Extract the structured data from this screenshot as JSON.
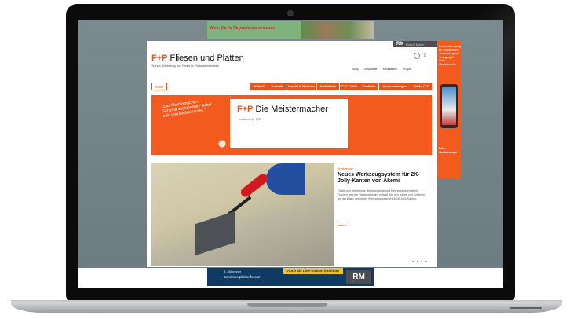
{
  "site": {
    "logo_prefix": "F+P",
    "logo_name": "Fliesen und Platten",
    "tagline": "Technik, Gestaltung und Trends für Fliesenfachbetriebe",
    "top_links": [
      "Shop",
      "Newsletter",
      "Mediadaten",
      "ePaper"
    ],
    "publisher_badge": "RM",
    "publisher_sub": "Rudolf Müller"
  },
  "top_banner": {
    "text": "Wenn Sie Ihr Netzwerk hier einsetzen"
  },
  "nav": {
    "home": "Home",
    "items": [
      "Aktuell",
      "Technik",
      "Handel & Betriebe",
      "Architektur",
      "F+P PLUS",
      "Produkte",
      "Veranstaltungen",
      "Mehr F+P"
    ]
  },
  "promo": {
    "speech": "„Das Meistermacher-Schema angemeldet? Dabei sein und leichter lernen.“",
    "title_prefix": "F+P",
    "title": "Die Meistermacher",
    "sub": "powered by PCI"
  },
  "article": {
    "label": "Werkzeuge",
    "title": "Neues Werkzeugsystem für 2K-Jolly-Kanten von Akemi",
    "body": "Glatte und einheitliche, fließgemachte und Rechenhindernisfreie Flächen wird bei Fliesenarbeiten gefragt. Mit den Jollies und Schienen auf der Basis der neuen Werkzeugsysteme für 2K-Jolly-Kanten.",
    "more": "mehr »",
    "pager": "● ● ● ●"
  },
  "side_ad": {
    "text": "Premiumwerkzeug für professionelle Verarbeitung und Verlegung für Ihren Meisterbetrieb",
    "cta": "Zum Onlineshop!"
  },
  "bottom_banner": {
    "line1": "4. Münchner",
    "line2": "Schimmelpilzkonferenz",
    "live": "Auch als Live-Stream buchbar!",
    "rm": "RM"
  }
}
